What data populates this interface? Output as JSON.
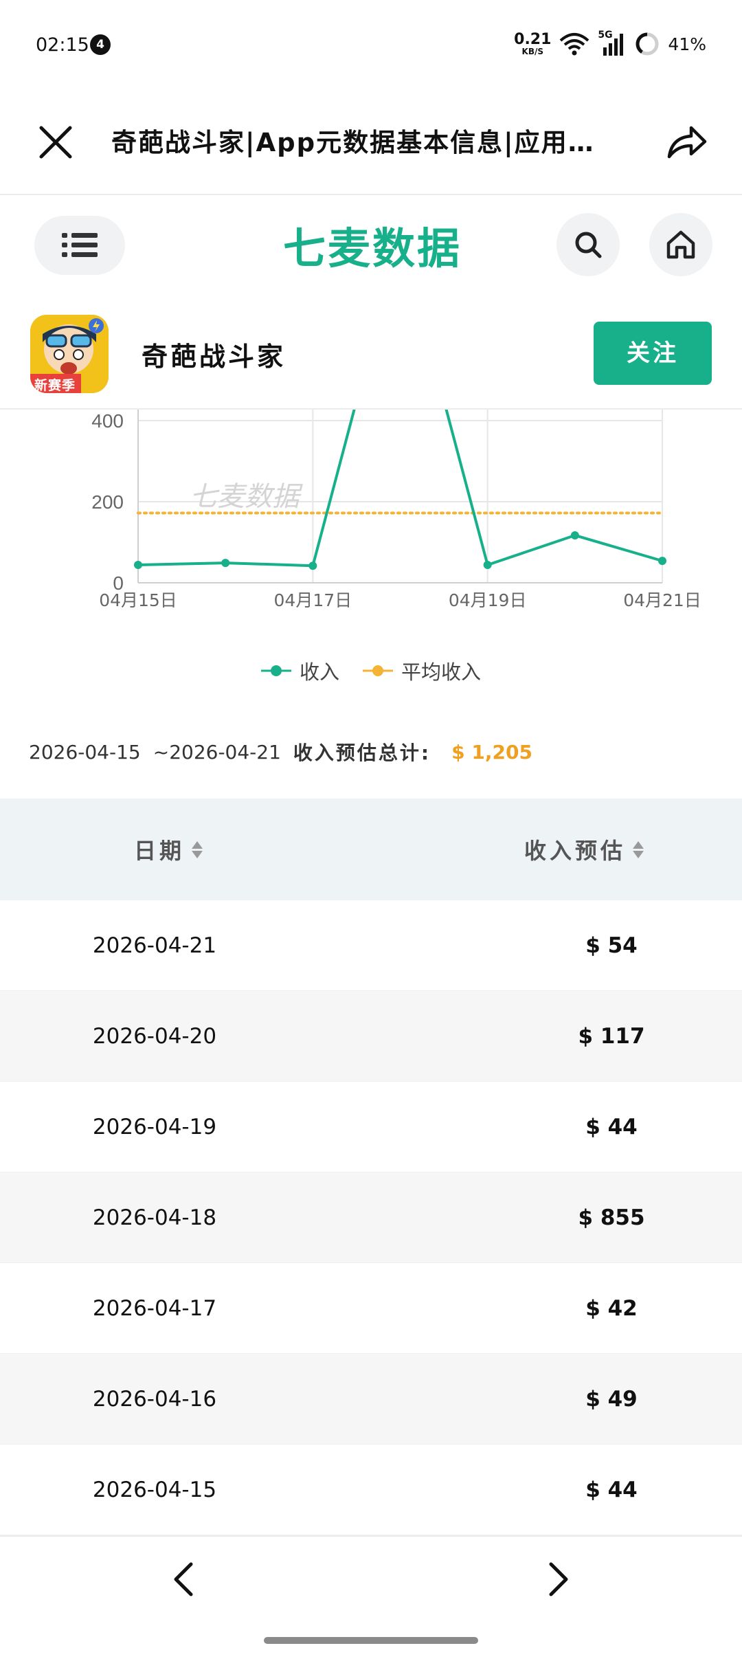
{
  "status_bar": {
    "time": "02:15",
    "notification_count": "4",
    "net_speed_value": "0.21",
    "net_speed_unit": "KB/S",
    "network_type": "5G",
    "battery": "41%"
  },
  "title_bar": {
    "title": "奇葩战斗家|App元数据基本信息|应用…",
    "close_icon": "close-icon",
    "share_icon": "share-icon"
  },
  "site_header": {
    "logo_text": "七麦数据",
    "menu_icon": "menu-list-icon",
    "search_icon": "search-icon",
    "home_icon": "home-icon"
  },
  "app": {
    "name": "奇葩战斗家",
    "icon_badge": "新赛季",
    "follow_label": "关注"
  },
  "chart_data": {
    "type": "line",
    "title": "",
    "xlabel": "",
    "ylabel": "",
    "x": [
      "04月15日",
      "04月16日",
      "04月17日",
      "04月18日",
      "04月19日",
      "04月20日",
      "04月21日"
    ],
    "x_tick_labels": [
      "04月15日",
      "04月17日",
      "04月19日",
      "04月21日"
    ],
    "y_tick_labels": [
      "0",
      "200",
      "400"
    ],
    "ylim": [
      0,
      400
    ],
    "grid": true,
    "watermark": "七麦数据",
    "series": [
      {
        "name": "收入",
        "values": [
          44,
          49,
          42,
          855,
          44,
          117,
          54
        ],
        "color": "#17b08a"
      },
      {
        "name": "平均收入",
        "values": [
          172,
          172,
          172,
          172,
          172,
          172,
          172
        ],
        "color": "#f5b335",
        "style": "dotted"
      }
    ],
    "legend_position": "bottom-center"
  },
  "summary": {
    "date_from": "2026-04-15",
    "date_to": "~2026-04-21",
    "label": "收入预估总计:",
    "total": "$ 1,205"
  },
  "table": {
    "headers": {
      "date": "日期",
      "revenue": "收入预估"
    },
    "rows": [
      {
        "date": "2026-04-21",
        "revenue": "$ 54"
      },
      {
        "date": "2026-04-20",
        "revenue": "$ 117"
      },
      {
        "date": "2026-04-19",
        "revenue": "$ 44"
      },
      {
        "date": "2026-04-18",
        "revenue": "$ 855"
      },
      {
        "date": "2026-04-17",
        "revenue": "$ 42"
      },
      {
        "date": "2026-04-16",
        "revenue": "$ 49"
      },
      {
        "date": "2026-04-15",
        "revenue": "$ 44"
      }
    ]
  },
  "bottom_nav": {
    "back_icon": "chevron-left-icon",
    "forward_icon": "chevron-right-icon"
  }
}
